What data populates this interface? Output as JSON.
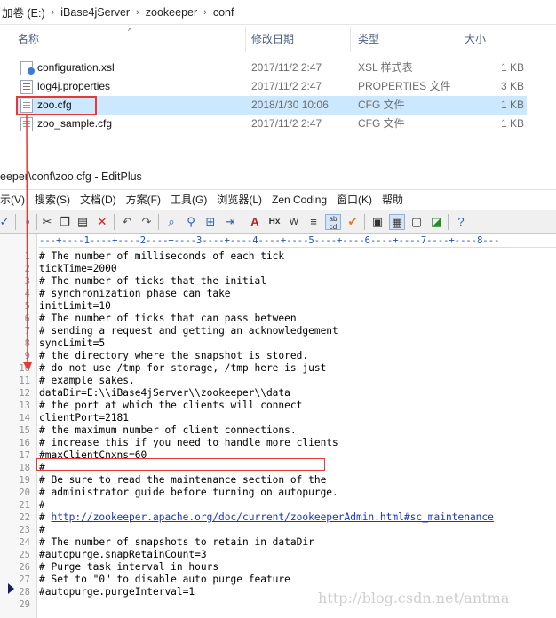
{
  "explorer": {
    "breadcrumb": [
      "加卷 (E:)",
      "iBase4jServer",
      "zookeeper",
      "conf"
    ],
    "columns": {
      "name": "名称",
      "date": "修改日期",
      "type": "类型",
      "size": "大小"
    },
    "files": [
      {
        "name": "configuration.xsl",
        "date": "2017/11/2 2:47",
        "type": "XSL 样式表",
        "size": "1 KB",
        "icon": "xsl-file-icon"
      },
      {
        "name": "log4j.properties",
        "date": "2017/11/2 2:47",
        "type": "PROPERTIES 文件",
        "size": "3 KB",
        "icon": "properties-file-icon"
      },
      {
        "name": "zoo.cfg",
        "date": "2018/1/30 10:06",
        "type": "CFG 文件",
        "size": "1 KB",
        "icon": "cfg-file-icon",
        "selected": true
      },
      {
        "name": "zoo_sample.cfg",
        "date": "2017/11/2 2:47",
        "type": "CFG 文件",
        "size": "1 KB",
        "icon": "cfg-file-icon"
      }
    ]
  },
  "editplus": {
    "title": "eeper\\conf\\zoo.cfg - EditPlus",
    "menu": [
      "示(V)",
      "搜索(S)",
      "文档(D)",
      "方案(F)",
      "工具(G)",
      "浏览器(L)",
      "Zen Coding",
      "窗口(K)",
      "帮助"
    ],
    "ruler": "---+----1----+----2----+----3----+----4----+----5----+----6----+----7----+----8---",
    "lines": [
      "# The number of milliseconds of each tick",
      "tickTime=2000",
      "# The number of ticks that the initial",
      "# synchronization phase can take",
      "initLimit=10",
      "# The number of ticks that can pass between",
      "# sending a request and getting an acknowledgement",
      "syncLimit=5",
      "# the directory where the snapshot is stored.",
      "# do not use /tmp for storage, /tmp here is just",
      "# example sakes.",
      "dataDir=E:\\\\iBase4jServer\\\\zookeeper\\\\data",
      "# the port at which the clients will connect",
      "clientPort=2181",
      "# the maximum number of client connections.",
      "# increase this if you need to handle more clients",
      "#maxClientCnxns=60",
      "#",
      "# Be sure to read the maintenance section of the",
      "# administrator guide before turning on autopurge.",
      "#",
      "# http://zookeeper.apache.org/doc/current/zookeeperAdmin.html#sc_maintenance",
      "#",
      "# The number of snapshots to retain in dataDir",
      "#autopurge.snapRetainCount=3",
      "# Purge task interval in hours",
      "# Set to \"0\" to disable auto purge feature",
      "#autopurge.purgeInterval=1",
      ""
    ],
    "link_line_index": 21,
    "highlight_line_index": 11
  },
  "watermark": "http://blog.csdn.net/antma",
  "colors": {
    "selection": "#cce8ff",
    "annotation": "#e53935",
    "link": "#1a33c8",
    "ruler": "#1f4fb8"
  }
}
